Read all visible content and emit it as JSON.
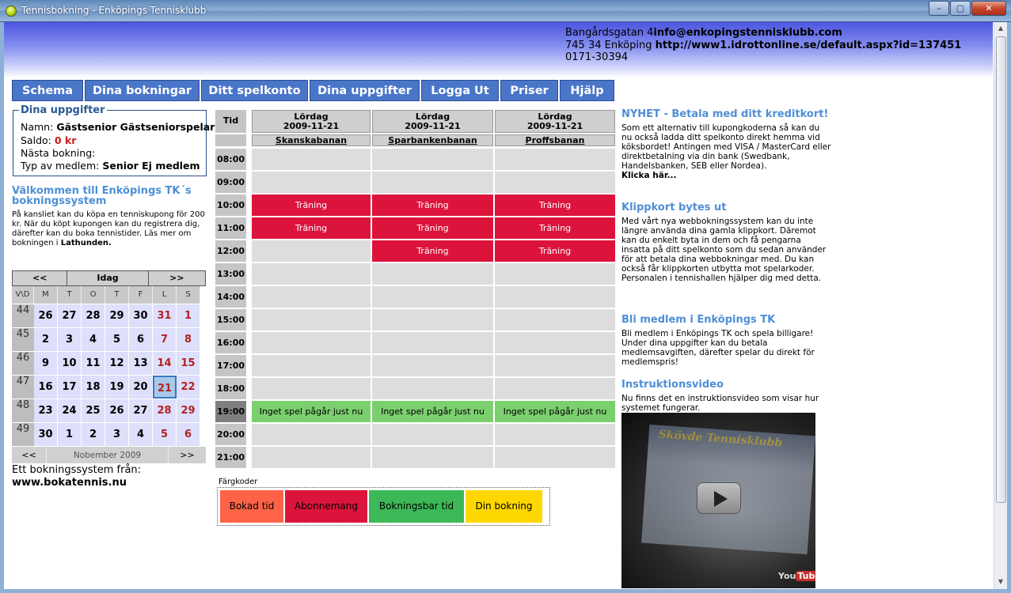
{
  "window": {
    "title": "Tennisbokning - Enköpings Tennisklubb"
  },
  "header": {
    "street": "Bangårdsgatan 4",
    "email": "info@enkopingstennisklubb.com",
    "postal": "745 34 Enköping",
    "url": "http://www1.idrottonline.se/default.aspx?id=137451",
    "phone": "0171-30394"
  },
  "nav": [
    "Schema",
    "Dina bokningar",
    "Ditt spelkonto",
    "Dina uppgifter",
    "Logga Ut",
    "Priser",
    "Hjälp"
  ],
  "user": {
    "legend": "Dina uppgifter",
    "name_label": "Namn:",
    "name": "Gästsenior Gästseniorspelare",
    "saldo_label": "Saldo:",
    "saldo": "0 kr",
    "next_label": "Nästa bokning:",
    "type_label": "Typ av medlem:",
    "type": "Senior Ej medlem"
  },
  "welcome": {
    "title": "Välkommen till Enköpings TK´s bokningssystem",
    "body": "På kansliet kan du köpa en tenniskupong för 200 kr. När du köpt kupongen kan du registrera dig, därefter kan du boka tennistider. Läs mer om bokningen i",
    "link": "Lathunden."
  },
  "calendar": {
    "prev": "<<",
    "today": "Idag",
    "next": ">>",
    "week_header": "V\\D",
    "days": [
      "M",
      "T",
      "O",
      "T",
      "F",
      "L",
      "S"
    ],
    "weeks": [
      {
        "wk": "44",
        "days": [
          "26",
          "27",
          "28",
          "29",
          "30",
          "31",
          "1"
        ]
      },
      {
        "wk": "45",
        "days": [
          "2",
          "3",
          "4",
          "5",
          "6",
          "7",
          "8"
        ]
      },
      {
        "wk": "46",
        "days": [
          "9",
          "10",
          "11",
          "12",
          "13",
          "14",
          "15"
        ]
      },
      {
        "wk": "47",
        "days": [
          "16",
          "17",
          "18",
          "19",
          "20",
          "21",
          "22"
        ]
      },
      {
        "wk": "48",
        "days": [
          "23",
          "24",
          "25",
          "26",
          "27",
          "28",
          "29"
        ]
      },
      {
        "wk": "49",
        "days": [
          "30",
          "1",
          "2",
          "3",
          "4",
          "5",
          "6"
        ]
      }
    ],
    "selected": "21",
    "month_prev": "<<",
    "month_label": "Nobember 2009",
    "month_next": ">>"
  },
  "booking_system": {
    "label": "Ett bokningssystem från:",
    "url": "www.bokatennis.nu"
  },
  "schedule": {
    "time_header": "Tid",
    "day_label": "Lördag",
    "date": "2009-11-21",
    "courts": [
      "Skanskabanan",
      "Sparbankenbanan",
      "Proffsbanan"
    ],
    "times": [
      "08:00",
      "09:00",
      "10:00",
      "11:00",
      "12:00",
      "13:00",
      "14:00",
      "15:00",
      "16:00",
      "17:00",
      "18:00",
      "19:00",
      "20:00",
      "21:00"
    ],
    "current_time": "19:00",
    "slots": [
      [
        "",
        "",
        ""
      ],
      [
        "",
        "",
        ""
      ],
      [
        "Träning",
        "Träning",
        "Träning"
      ],
      [
        "Träning",
        "Träning",
        "Träning"
      ],
      [
        "",
        "Träning",
        "Träning"
      ],
      [
        "",
        "",
        ""
      ],
      [
        "",
        "",
        ""
      ],
      [
        "",
        "",
        ""
      ],
      [
        "",
        "",
        ""
      ],
      [
        "",
        "",
        ""
      ],
      [
        "",
        "",
        ""
      ],
      [
        "Inget spel pågår just nu",
        "Inget spel pågår just nu",
        "Inget spel pågår just nu"
      ],
      [
        "",
        "",
        ""
      ],
      [
        "",
        "",
        ""
      ]
    ]
  },
  "legend": {
    "title": "Färgkoder",
    "items": [
      {
        "label": "Bokad tid",
        "color": "#ff6347"
      },
      {
        "label": "Abonnemang",
        "color": "#dc143c"
      },
      {
        "label": "Bokningsbar tid",
        "color": "#3cb858"
      },
      {
        "label": "Din bokning",
        "color": "#ffd700"
      }
    ]
  },
  "news": [
    {
      "title": "NYHET - Betala med ditt kreditkort!",
      "body": "Som ett alternativ till kupongkoderna så kan du nu också ladda ditt spelkonto direkt hemma vid köksbordet! Antingen med VISA / MasterCard eller direktbetalning via din bank (Swedbank, Handelsbanken, SEB eller Nordea).",
      "link": "Klicka här..."
    },
    {
      "title": "Klippkort bytes ut",
      "body": "Med vårt nya webbokningssystem kan du inte längre använda dina gamla klippkort. Däremot kan du enkelt byta in dem och få pengarna insatta på ditt spelkonto som du sedan använder för att betala dina webbokningar med. Du kan också får klippkorten utbytta mot spelarkoder. Personalen i tennishallen hjälper dig med detta.",
      "link": ""
    },
    {
      "title": "Bli medlem i Enköpings TK",
      "body": "Bli medlem i Enköpings TK och spela billigare! Under dina uppgifter kan du betala medlemsavgiften, därefter spelar du direkt för medlemspris!",
      "link": ""
    },
    {
      "title": "Instruktionsvideo",
      "body": "Nu finns det en instruktionsvideo som visar hur systemet fungerar.",
      "link": ""
    }
  ],
  "video": {
    "brand": "Skövde Tennisklubb",
    "yt_you": "You",
    "yt_tube": "Tube"
  },
  "colors": {
    "nav": "#4a76c9",
    "training": "#dc143c",
    "now_playing": "#7ccf6f",
    "free": "#dddddd",
    "accent_text": "#4e8fd6"
  }
}
